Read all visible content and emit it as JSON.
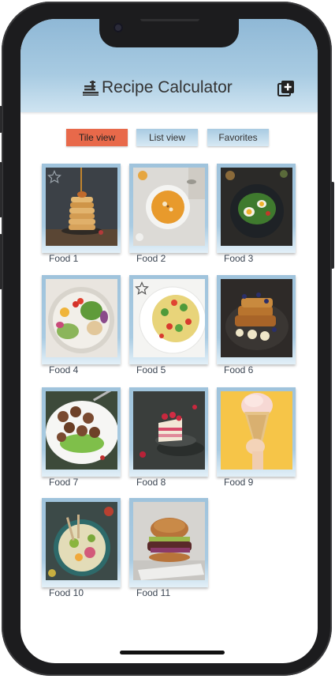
{
  "app": {
    "title": "Recipe Calculator",
    "header_icon": "chef-hat-icon",
    "add_icon": "add-square-icon",
    "accent_color": "#e8694a",
    "header_color": "#a8cbe2"
  },
  "tabs": [
    {
      "label": "Tile view",
      "active": true
    },
    {
      "label": "List view",
      "active": false
    },
    {
      "label": "Favorites",
      "active": false
    }
  ],
  "foods": [
    {
      "label": "Food 1",
      "favorite": true,
      "scene": "pancakes"
    },
    {
      "label": "Food 2",
      "favorite": false,
      "scene": "soup"
    },
    {
      "label": "Food 3",
      "favorite": false,
      "scene": "salad-eggs"
    },
    {
      "label": "Food 4",
      "favorite": false,
      "scene": "buddha-bowl"
    },
    {
      "label": "Food 5",
      "favorite": true,
      "scene": "pasta-salad"
    },
    {
      "label": "Food 6",
      "favorite": false,
      "scene": "french-toast"
    },
    {
      "label": "Food 7",
      "favorite": false,
      "scene": "meatballs"
    },
    {
      "label": "Food 8",
      "favorite": false,
      "scene": "cake"
    },
    {
      "label": "Food 9",
      "favorite": false,
      "scene": "ice-cream"
    },
    {
      "label": "Food 10",
      "favorite": false,
      "scene": "grain-bowl"
    },
    {
      "label": "Food 11",
      "favorite": false,
      "scene": "burger"
    }
  ]
}
